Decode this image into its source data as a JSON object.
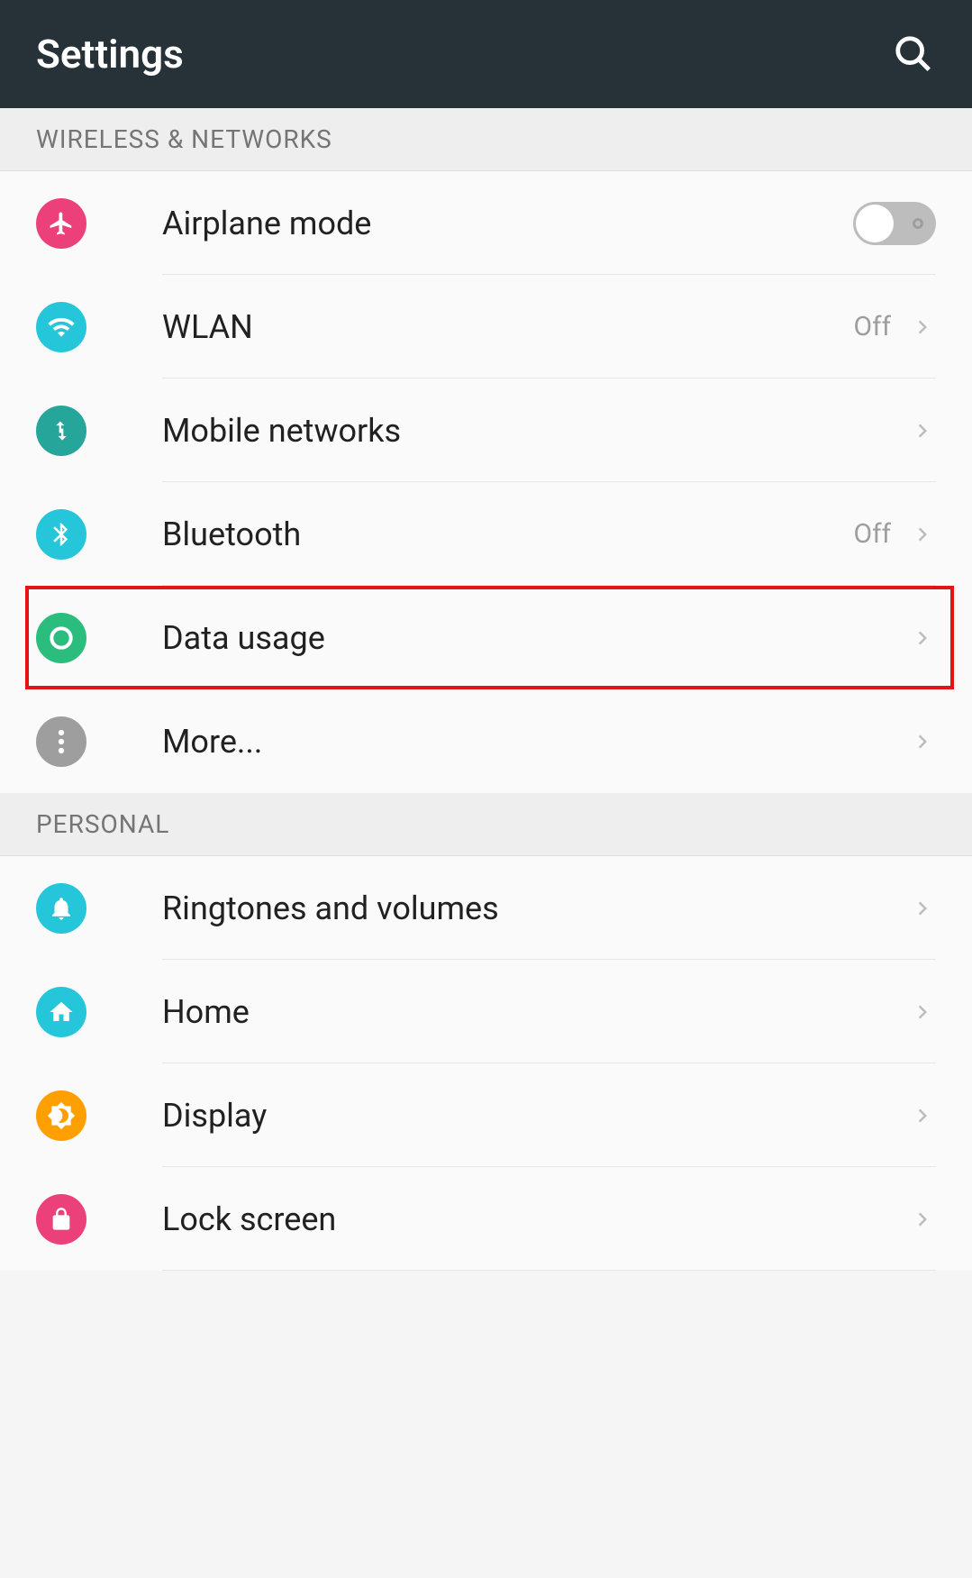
{
  "header": {
    "title": "Settings"
  },
  "sections": {
    "wireless": {
      "header": "WIRELESS & NETWORKS",
      "items": {
        "airplane": {
          "label": "Airplane mode"
        },
        "wlan": {
          "label": "WLAN",
          "status": "Off"
        },
        "mobile_networks": {
          "label": "Mobile networks"
        },
        "bluetooth": {
          "label": "Bluetooth",
          "status": "Off"
        },
        "data_usage": {
          "label": "Data usage"
        },
        "more": {
          "label": "More..."
        }
      }
    },
    "personal": {
      "header": "PERSONAL",
      "items": {
        "ringtones": {
          "label": "Ringtones and volumes"
        },
        "home": {
          "label": "Home"
        },
        "display": {
          "label": "Display"
        },
        "lock_screen": {
          "label": "Lock screen"
        }
      }
    }
  }
}
